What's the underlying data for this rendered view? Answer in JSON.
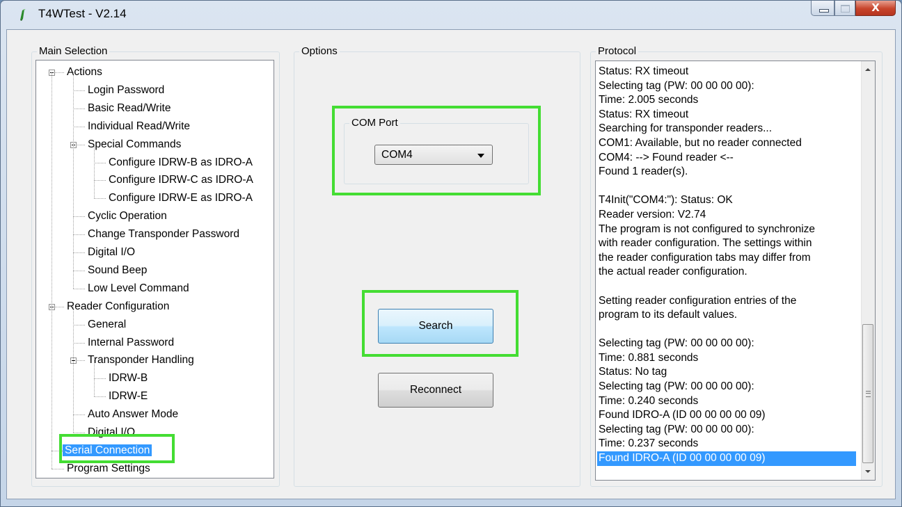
{
  "window": {
    "title": "T4WTest - V2.14",
    "close_glyph": "X"
  },
  "main_selection": {
    "legend": "Main Selection",
    "items": [
      {
        "label": "Actions",
        "level": 0,
        "expander": true
      },
      {
        "label": "Login Password",
        "level": 1
      },
      {
        "label": "Basic Read/Write",
        "level": 1
      },
      {
        "label": "Individual Read/Write",
        "level": 1
      },
      {
        "label": "Special Commands",
        "level": 1,
        "expander": true
      },
      {
        "label": "Configure IDRW-B as IDRO-A",
        "level": 2
      },
      {
        "label": "Configure IDRW-C as IDRO-A",
        "level": 2
      },
      {
        "label": "Configure IDRW-E as IDRO-A",
        "level": 2
      },
      {
        "label": "Cyclic Operation",
        "level": 1
      },
      {
        "label": "Change Transponder Password",
        "level": 1
      },
      {
        "label": "Digital I/O",
        "level": 1
      },
      {
        "label": "Sound Beep",
        "level": 1
      },
      {
        "label": "Low Level Command",
        "level": 1
      },
      {
        "label": "Reader Configuration",
        "level": 0,
        "expander": true
      },
      {
        "label": "General",
        "level": 1
      },
      {
        "label": "Internal Password",
        "level": 1
      },
      {
        "label": "Transponder Handling",
        "level": 1,
        "expander": true
      },
      {
        "label": "IDRW-B",
        "level": 2
      },
      {
        "label": "IDRW-E",
        "level": 2
      },
      {
        "label": "Auto Answer Mode",
        "level": 1
      },
      {
        "label": "Digital I/O",
        "level": 1
      },
      {
        "label": "Serial Connection",
        "level": 0,
        "selected": true
      },
      {
        "label": "Program Settings",
        "level": 0
      }
    ]
  },
  "options": {
    "legend": "Options",
    "com_port_legend": "COM Port",
    "com_port_value": "COM4",
    "search_label": "Search",
    "reconnect_label": "Reconnect"
  },
  "protocol": {
    "legend": "Protocol",
    "lines": [
      "Status: RX timeout",
      "Selecting tag (PW: 00 00 00 00):",
      "Time: 2.005 seconds",
      "Status: RX timeout",
      "Searching for transponder readers...",
      "COM1: Available, but no reader connected",
      "COM4: --> Found reader <--",
      "Found 1 reader(s).",
      "",
      "T4Init(\"COM4:\"): Status: OK",
      "Reader version: V2.74",
      "The program is not configured to synchronize",
      "with reader configuration. The settings within",
      "the reader configuration tabs may differ from",
      "the actual reader configuration.",
      "",
      "Setting reader configuration entries of the",
      "program to its default values.",
      "",
      "Selecting tag (PW: 00 00 00 00):",
      "Time: 0.881 seconds",
      "Status: No tag",
      "Selecting tag (PW: 00 00 00 00):",
      "Time: 0.240 seconds",
      "Found IDRO-A (ID 00 00 00 00 09)",
      "Selecting tag (PW: 00 00 00 00):",
      "Time: 0.237 seconds",
      "Found IDRO-A (ID 00 00 00 00 09)"
    ],
    "selected_line": 27
  },
  "colors": {
    "highlight_box": "#44dd33",
    "selection": "#3399ff"
  }
}
